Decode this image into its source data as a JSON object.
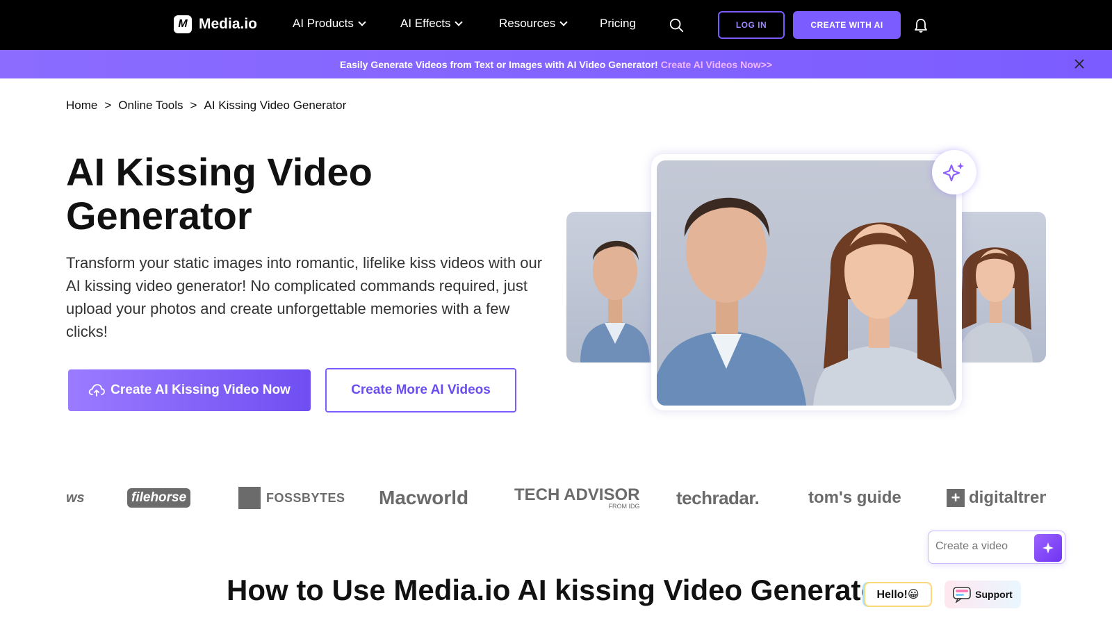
{
  "nav": {
    "logo_text": "Media.io",
    "items": [
      {
        "label": "AI Products"
      },
      {
        "label": "AI Effects"
      },
      {
        "label": "Resources"
      },
      {
        "label": "Pricing"
      }
    ],
    "login": "LOG IN",
    "create": "CREATE WITH AI"
  },
  "banner": {
    "text": " Easily Generate Videos from Text or Images with AI Video Generator! ",
    "link": "Create AI Videos Now>>"
  },
  "breadcrumb": {
    "items": [
      "Home",
      "Online Tools",
      "AI Kissing Video Generator"
    ],
    "separator": ">"
  },
  "hero": {
    "title": "AI Kissing Video Generator",
    "description": "Transform your static images into romantic, lifelike kiss videos with our AI kissing video generator! No complicated commands required, just upload your photos and create unforgettable memories with a few clicks!",
    "primary_button": "Create AI Kissing Video Now",
    "secondary_button": "Create More AI Videos"
  },
  "press_logos": [
    "ws",
    "filehorse",
    "FOSSBYTES",
    "Macworld",
    "TECH ADVISOR",
    "FROM IDG",
    "techradar.",
    "tom's guide",
    "digitaltrend"
  ],
  "widget": {
    "placeholder": "Create a video"
  },
  "section": {
    "title": "How to Use Media.io AI kissing Video Generator"
  },
  "chat": {
    "hello": "Hello!😀",
    "support": "Support"
  },
  "colors": {
    "brand_purple": "#7b5cff",
    "nav_bg": "#000000"
  }
}
